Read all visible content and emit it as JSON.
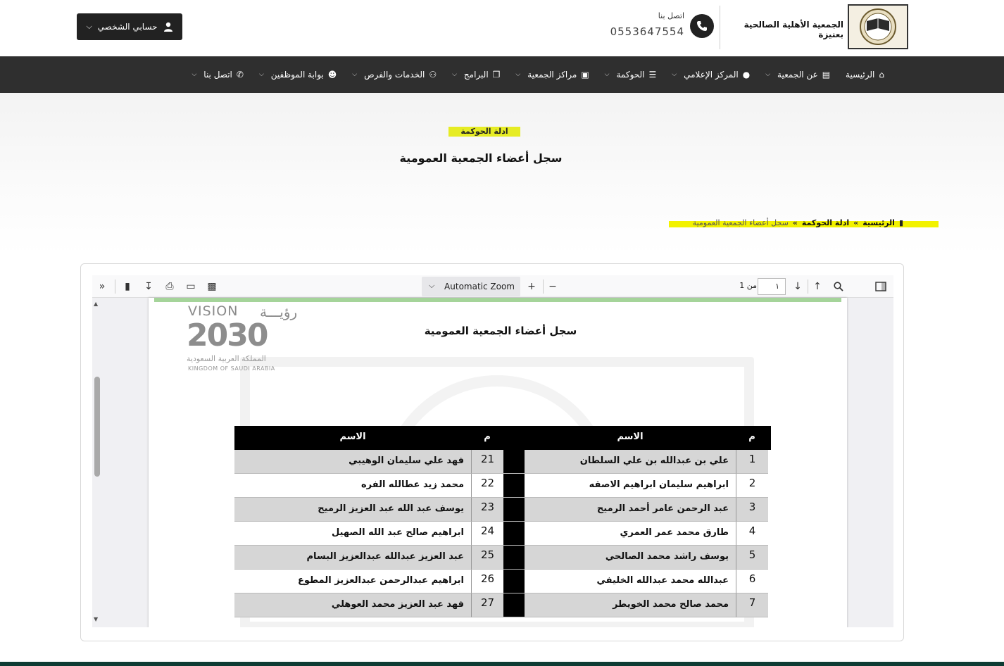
{
  "header": {
    "org_name": "الجمعية الأهلية الصالحية بعنيزة",
    "contact_label": "اتصل بنا",
    "contact_phone": "0553647554",
    "account_label": "حسابي الشخصي"
  },
  "nav": {
    "items": [
      {
        "label": "الرئيسية",
        "icon": "home-icon",
        "dropdown": false
      },
      {
        "label": "عن الجمعية",
        "icon": "id-card-icon",
        "dropdown": true
      },
      {
        "label": "المركز الإعلامي",
        "icon": "microphone-icon",
        "dropdown": true
      },
      {
        "label": "الحوكمة",
        "icon": "list-icon",
        "dropdown": true
      },
      {
        "label": "مراكز الجمعية",
        "icon": "folder-icon",
        "dropdown": true
      },
      {
        "label": "البرامج",
        "icon": "copy-icon",
        "dropdown": true
      },
      {
        "label": "الخدمات والفرص",
        "icon": "users-icon",
        "dropdown": true
      },
      {
        "label": "بوابة الموظفين",
        "icon": "user-plus-icon",
        "dropdown": true
      },
      {
        "label": "اتصل بنا",
        "icon": "phone-icon",
        "dropdown": true
      }
    ]
  },
  "hero": {
    "kicker": "ادلة الحوكمة",
    "title": "سجل أعضاء الجمعية العمومية"
  },
  "breadcrumb": {
    "home": "الرئيسية",
    "sep1": "»",
    "section": "ادلة الحوكمة",
    "sep2": "»",
    "current": "سجل أعضاء الجمعية العمومية"
  },
  "viewer": {
    "zoom": "Automatic Zoom",
    "page_current": "١",
    "page_of": "من 1"
  },
  "document": {
    "title": "سجل أعضاء الجمعية العمومية",
    "vision_top": "VISION",
    "vision_top_ar": "رؤيـــة",
    "vision_num": "2030",
    "vision_ar": "المملكة العربية السعودية",
    "vision_en": "KINGDOM OF SAUDI ARABIA",
    "col_num": "م",
    "col_name": "الاسم",
    "right_rows": [
      {
        "n": "1",
        "name": "علي بن عبدالله بن علي السلطان"
      },
      {
        "n": "2",
        "name": "ابراهيم سليمان ابراهيم الاصقه"
      },
      {
        "n": "3",
        "name": "عبد الرحمن عامر أحمد الرميح"
      },
      {
        "n": "4",
        "name": "طارق محمد عمر العمري"
      },
      {
        "n": "5",
        "name": "يوسف راشد محمد الصالحي"
      },
      {
        "n": "6",
        "name": "عبدالله محمد عبدالله الخليفي"
      },
      {
        "n": "7",
        "name": "محمد صالح محمد الخويطر"
      }
    ],
    "left_rows": [
      {
        "n": "21",
        "name": "فهد علي سليمان الوهيبي"
      },
      {
        "n": "22",
        "name": "محمد زيد عطالله الفره"
      },
      {
        "n": "23",
        "name": "يوسف عبد الله عبد العزيز الرميح"
      },
      {
        "n": "24",
        "name": "ابراهيم صالح عبد الله الصهيل"
      },
      {
        "n": "25",
        "name": "عبد العزيز عبدالله عبدالعزيز البسام"
      },
      {
        "n": "26",
        "name": "ابراهيم عبدالرحمن عبدالعزيز المطوع"
      },
      {
        "n": "27",
        "name": "فهد عبد العزيز محمد العوهلي"
      }
    ]
  },
  "colors": {
    "nav_bg": "#2f2f2f",
    "highlight": "#e6ec24",
    "table_head": "#000000",
    "row_alt": "#d6d6d6",
    "footer": "#0e3b33"
  }
}
